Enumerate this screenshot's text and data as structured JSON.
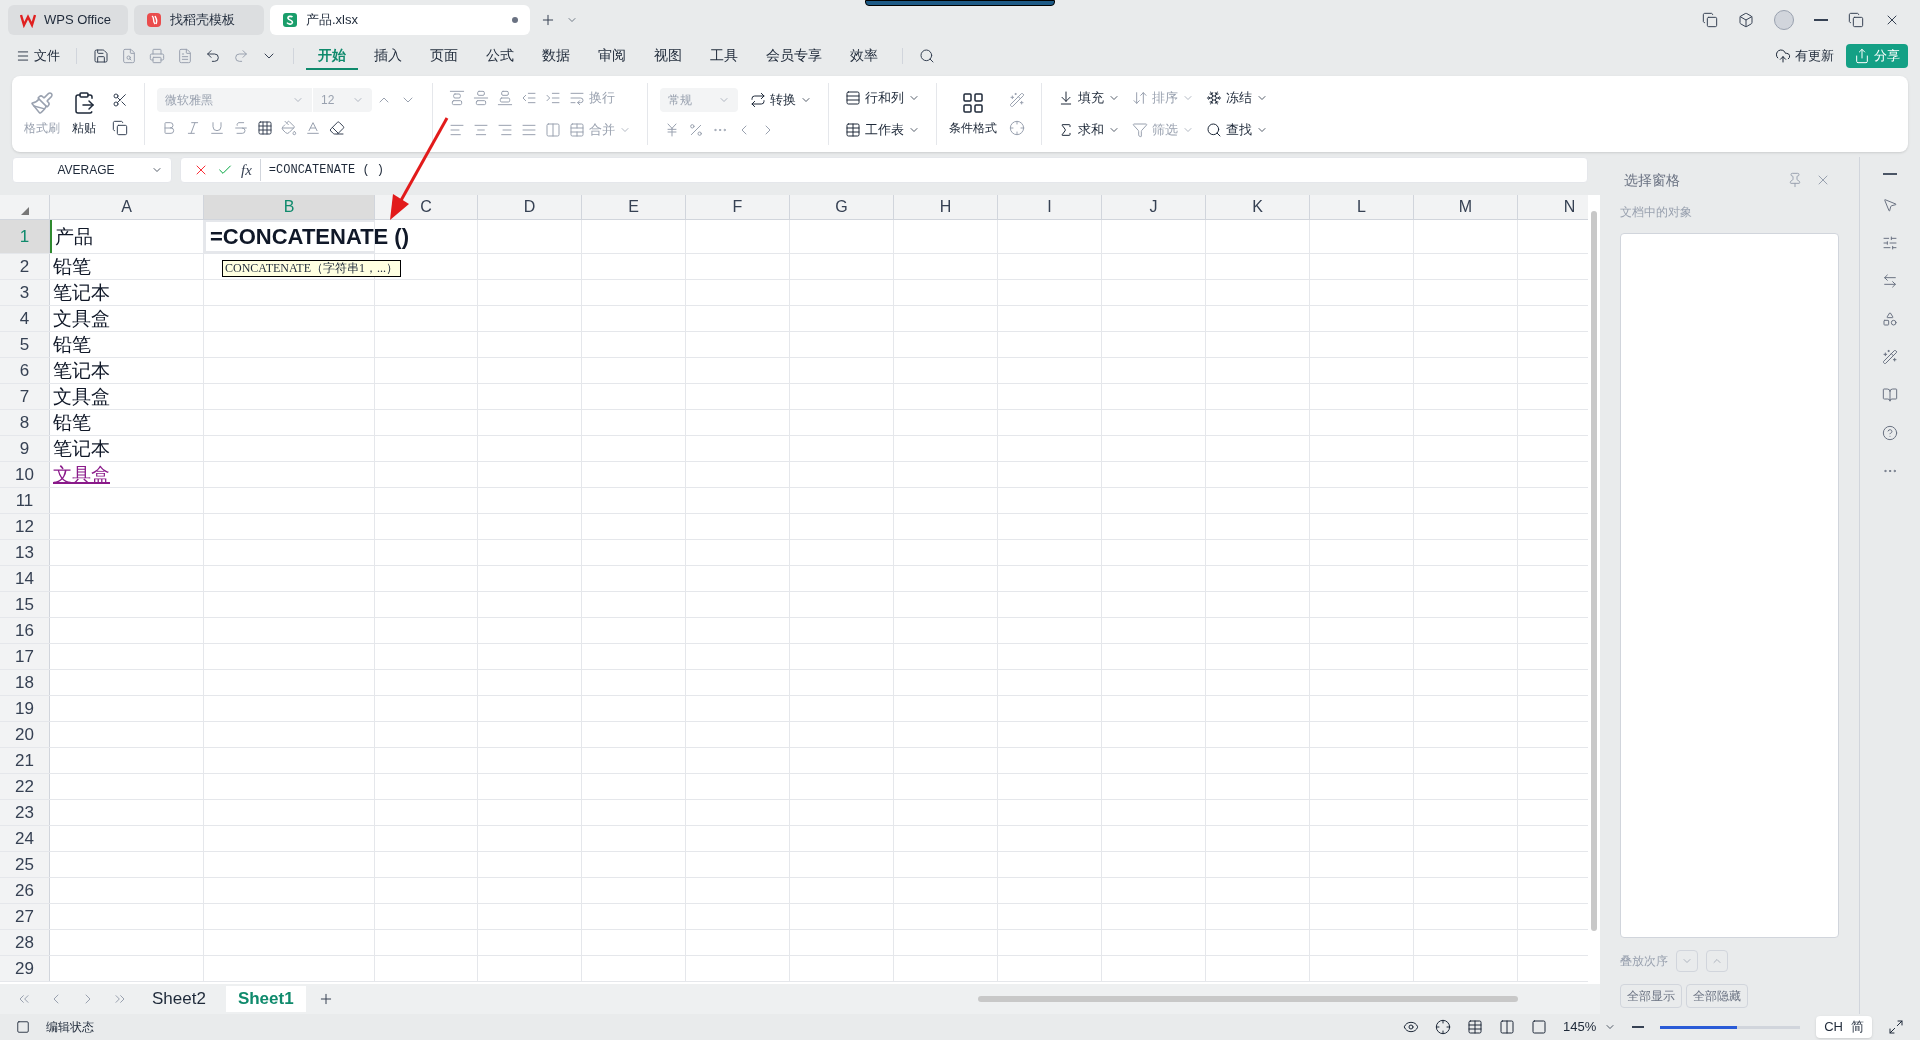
{
  "tabs": [
    {
      "label": "WPS Office",
      "selected": false
    },
    {
      "label": "找稻壳模板",
      "selected": false
    },
    {
      "label": "产品.xlsx",
      "selected": true
    }
  ],
  "menu": {
    "file": "文件",
    "tabs": [
      {
        "label": "开始",
        "selected": true
      },
      {
        "label": "插入",
        "selected": false
      },
      {
        "label": "页面",
        "selected": false
      },
      {
        "label": "公式",
        "selected": false
      },
      {
        "label": "数据",
        "selected": false
      },
      {
        "label": "审阅",
        "selected": false
      },
      {
        "label": "视图",
        "selected": false
      },
      {
        "label": "工具",
        "selected": false
      },
      {
        "label": "会员专享",
        "selected": false
      },
      {
        "label": "效率",
        "selected": false
      }
    ],
    "update": "有更新",
    "share": "分享"
  },
  "ribbon": {
    "paint": {
      "label": "格式刷",
      "disabled": true
    },
    "paste": {
      "label": "粘贴",
      "disabled": false
    },
    "font": {
      "name": "微软雅黑",
      "size": "12",
      "disabled": true
    },
    "wrap": {
      "label": "换行",
      "disabled": true
    },
    "merge": {
      "label": "合并",
      "disabled": true
    },
    "number_format": "常规",
    "convert": {
      "label": "转换",
      "disabled": false
    },
    "rows_cols": {
      "label": "行和列",
      "disabled": false
    },
    "worksheet": {
      "label": "工作表",
      "disabled": false
    },
    "cond_format": {
      "label": "条件格式",
      "disabled": false
    },
    "fill": {
      "label": "填充",
      "disabled": false
    },
    "sort": {
      "label": "排序",
      "disabled": true
    },
    "freeze": {
      "label": "冻结",
      "disabled": false
    },
    "sum": {
      "label": "求和",
      "disabled": false
    },
    "filter": {
      "label": "筛选",
      "disabled": true
    },
    "find": {
      "label": "查找",
      "disabled": false
    }
  },
  "formula_bar": {
    "name_box": "AVERAGE",
    "fx": "fx",
    "formula": "=CONCATENATE ( )"
  },
  "sheet": {
    "columns": [
      {
        "label": "A",
        "selected": false
      },
      {
        "label": "B",
        "selected": true
      },
      {
        "label": "C",
        "selected": false
      },
      {
        "label": "D",
        "selected": false
      },
      {
        "label": "E",
        "selected": false
      },
      {
        "label": "F",
        "selected": false
      },
      {
        "label": "G",
        "selected": false
      },
      {
        "label": "H",
        "selected": false
      },
      {
        "label": "I",
        "selected": false
      },
      {
        "label": "J",
        "selected": false
      },
      {
        "label": "K",
        "selected": false
      },
      {
        "label": "L",
        "selected": false
      },
      {
        "label": "M",
        "selected": false
      },
      {
        "label": "N",
        "selected": false
      }
    ],
    "rows": [
      {
        "label": "1",
        "selected": true,
        "cells": [
          {
            "text": "产品",
            "kind": "text"
          },
          {
            "text": "=CONCATENATE ()",
            "kind": "editing"
          }
        ]
      },
      {
        "label": "2",
        "selected": false,
        "cells": [
          {
            "text": "铅笔",
            "kind": "text"
          }
        ]
      },
      {
        "label": "3",
        "selected": false,
        "cells": [
          {
            "text": "笔记本",
            "kind": "text"
          }
        ]
      },
      {
        "label": "4",
        "selected": false,
        "cells": [
          {
            "text": "文具盒",
            "kind": "text"
          }
        ]
      },
      {
        "label": "5",
        "selected": false,
        "cells": [
          {
            "text": "铅笔",
            "kind": "text"
          }
        ]
      },
      {
        "label": "6",
        "selected": false,
        "cells": [
          {
            "text": "笔记本",
            "kind": "text"
          }
        ]
      },
      {
        "label": "7",
        "selected": false,
        "cells": [
          {
            "text": "文具盒",
            "kind": "text"
          }
        ]
      },
      {
        "label": "8",
        "selected": false,
        "cells": [
          {
            "text": "铅笔",
            "kind": "text"
          }
        ]
      },
      {
        "label": "9",
        "selected": false,
        "cells": [
          {
            "text": "笔记本",
            "kind": "text"
          }
        ]
      },
      {
        "label": "10",
        "selected": false,
        "cells": [
          {
            "text": "文具盒",
            "kind": "link"
          }
        ]
      },
      {
        "label": "11",
        "selected": false
      },
      {
        "label": "12",
        "selected": false
      },
      {
        "label": "13",
        "selected": false
      },
      {
        "label": "14",
        "selected": false
      },
      {
        "label": "15",
        "selected": false
      },
      {
        "label": "16",
        "selected": false
      },
      {
        "label": "17",
        "selected": false
      },
      {
        "label": "18",
        "selected": false
      },
      {
        "label": "19",
        "selected": false
      },
      {
        "label": "20",
        "selected": false
      },
      {
        "label": "21",
        "selected": false
      },
      {
        "label": "22",
        "selected": false
      },
      {
        "label": "23",
        "selected": false
      },
      {
        "label": "24",
        "selected": false
      },
      {
        "label": "25",
        "selected": false
      },
      {
        "label": "26",
        "selected": false
      },
      {
        "label": "27",
        "selected": false
      },
      {
        "label": "28",
        "selected": false
      },
      {
        "label": "29",
        "selected": false
      }
    ],
    "tooltip": "CONCATENATE（字符串1，...）"
  },
  "sheet_tabs": [
    {
      "label": "Sheet2",
      "selected": false
    },
    {
      "label": "Sheet1",
      "selected": true
    }
  ],
  "pane": {
    "title": "选择窗格",
    "subtitle": "文档中的对象",
    "order_label": "叠放次序",
    "buttons": [
      "全部显示",
      "全部隐藏"
    ]
  },
  "status": {
    "mode": "编辑状态",
    "zoom": "145%",
    "zoom_slider": {
      "level": 0.55
    },
    "ime": {
      "lang": "CH",
      "mode": "简"
    }
  }
}
